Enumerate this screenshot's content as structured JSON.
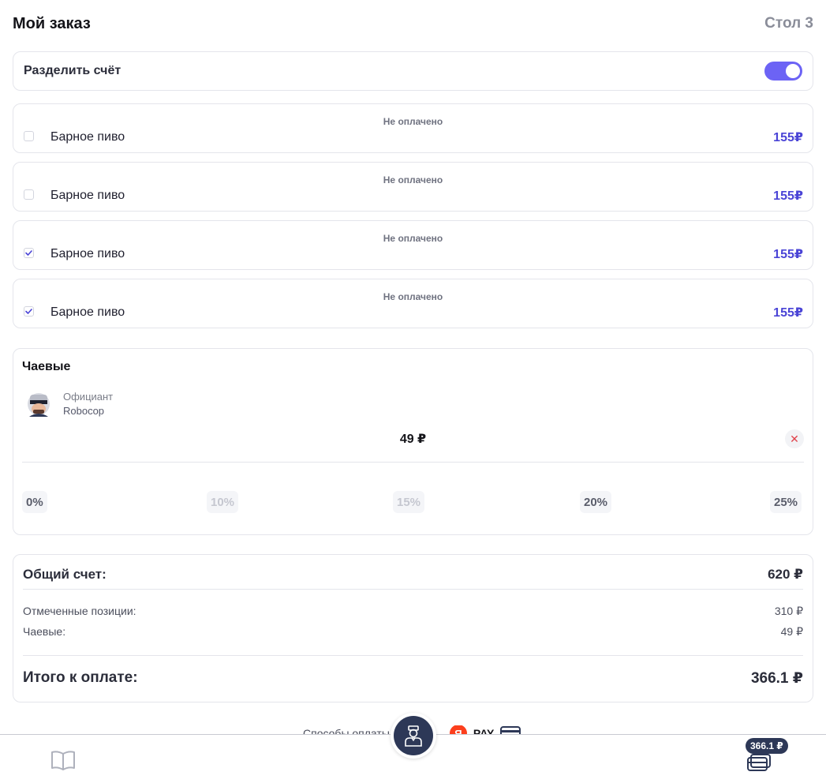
{
  "header": {
    "title": "Мой заказ",
    "table": "Стол 3"
  },
  "split": {
    "label": "Разделить счёт",
    "enabled": true
  },
  "items": [
    {
      "status": "Не оплачено",
      "name": "Барное пиво",
      "price": "155₽",
      "checked": false
    },
    {
      "status": "Не оплачено",
      "name": "Барное пиво",
      "price": "155₽",
      "checked": false
    },
    {
      "status": "Не оплачено",
      "name": "Барное пиво",
      "price": "155₽",
      "checked": true
    },
    {
      "status": "Не оплачено",
      "name": "Барное пиво",
      "price": "155₽",
      "checked": true
    }
  ],
  "tips": {
    "title": "Чаевые",
    "waiter_role": "Официант",
    "waiter_name": "Robocop",
    "amount": "49 ₽",
    "clear_icon": "close-icon",
    "percents": [
      {
        "label": "0%",
        "active": true
      },
      {
        "label": "10%",
        "active": false
      },
      {
        "label": "15%",
        "active": false
      },
      {
        "label": "20%",
        "active": true
      },
      {
        "label": "25%",
        "active": true
      }
    ]
  },
  "totals": {
    "total_label": "Общий счет:",
    "total_value": "620 ₽",
    "checked_label": "Отмеченные позиции:",
    "checked_value": "310 ₽",
    "tips_label": "Чаевые:",
    "tips_value": "49 ₽",
    "final_label": "Итого к оплате:",
    "final_value": "366.1 ₽"
  },
  "payment": {
    "label": "Способы оплаты",
    "ya_letter": "Я",
    "pay_word": "PAY"
  },
  "bottom_nav": {
    "cart_badge": "366.1 ₽",
    "menu_icon": "book-icon",
    "waiter_icon": "waiter-icon",
    "cart_icon": "cards-icon"
  },
  "colors": {
    "accent": "#6c63f5",
    "price": "#4a44d6",
    "navy": "#2d3857",
    "danger": "#e0424b"
  }
}
